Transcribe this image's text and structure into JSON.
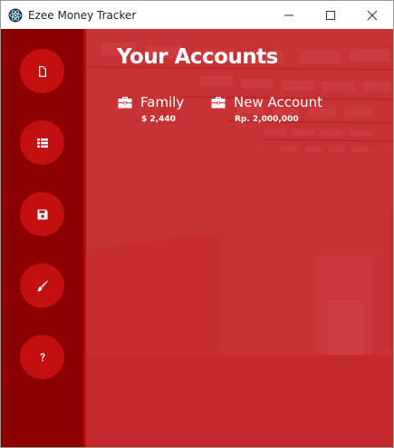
{
  "window": {
    "title": "Ezee Money Tracker",
    "controls": [
      "minimize",
      "maximize",
      "close"
    ]
  },
  "colors": {
    "sidebar": "#8c0000",
    "sidebar_button": "#c30f0f",
    "background_overlay": "#c41f22",
    "text": "#ffffff"
  },
  "sidebar": {
    "items": [
      {
        "name": "new-file",
        "icon": "file-icon"
      },
      {
        "name": "list",
        "icon": "list-icon"
      },
      {
        "name": "save",
        "icon": "floppy-disk-icon"
      },
      {
        "name": "theme",
        "icon": "paintbrush-icon"
      },
      {
        "name": "help",
        "icon": "question-icon"
      }
    ]
  },
  "main": {
    "title": "Your Accounts",
    "accounts": [
      {
        "name": "Family",
        "balance": "$ 2,440",
        "icon": "briefcase-icon"
      },
      {
        "name": "New Account",
        "balance": "Rp. 2,000,000",
        "icon": "briefcase-icon"
      }
    ]
  }
}
